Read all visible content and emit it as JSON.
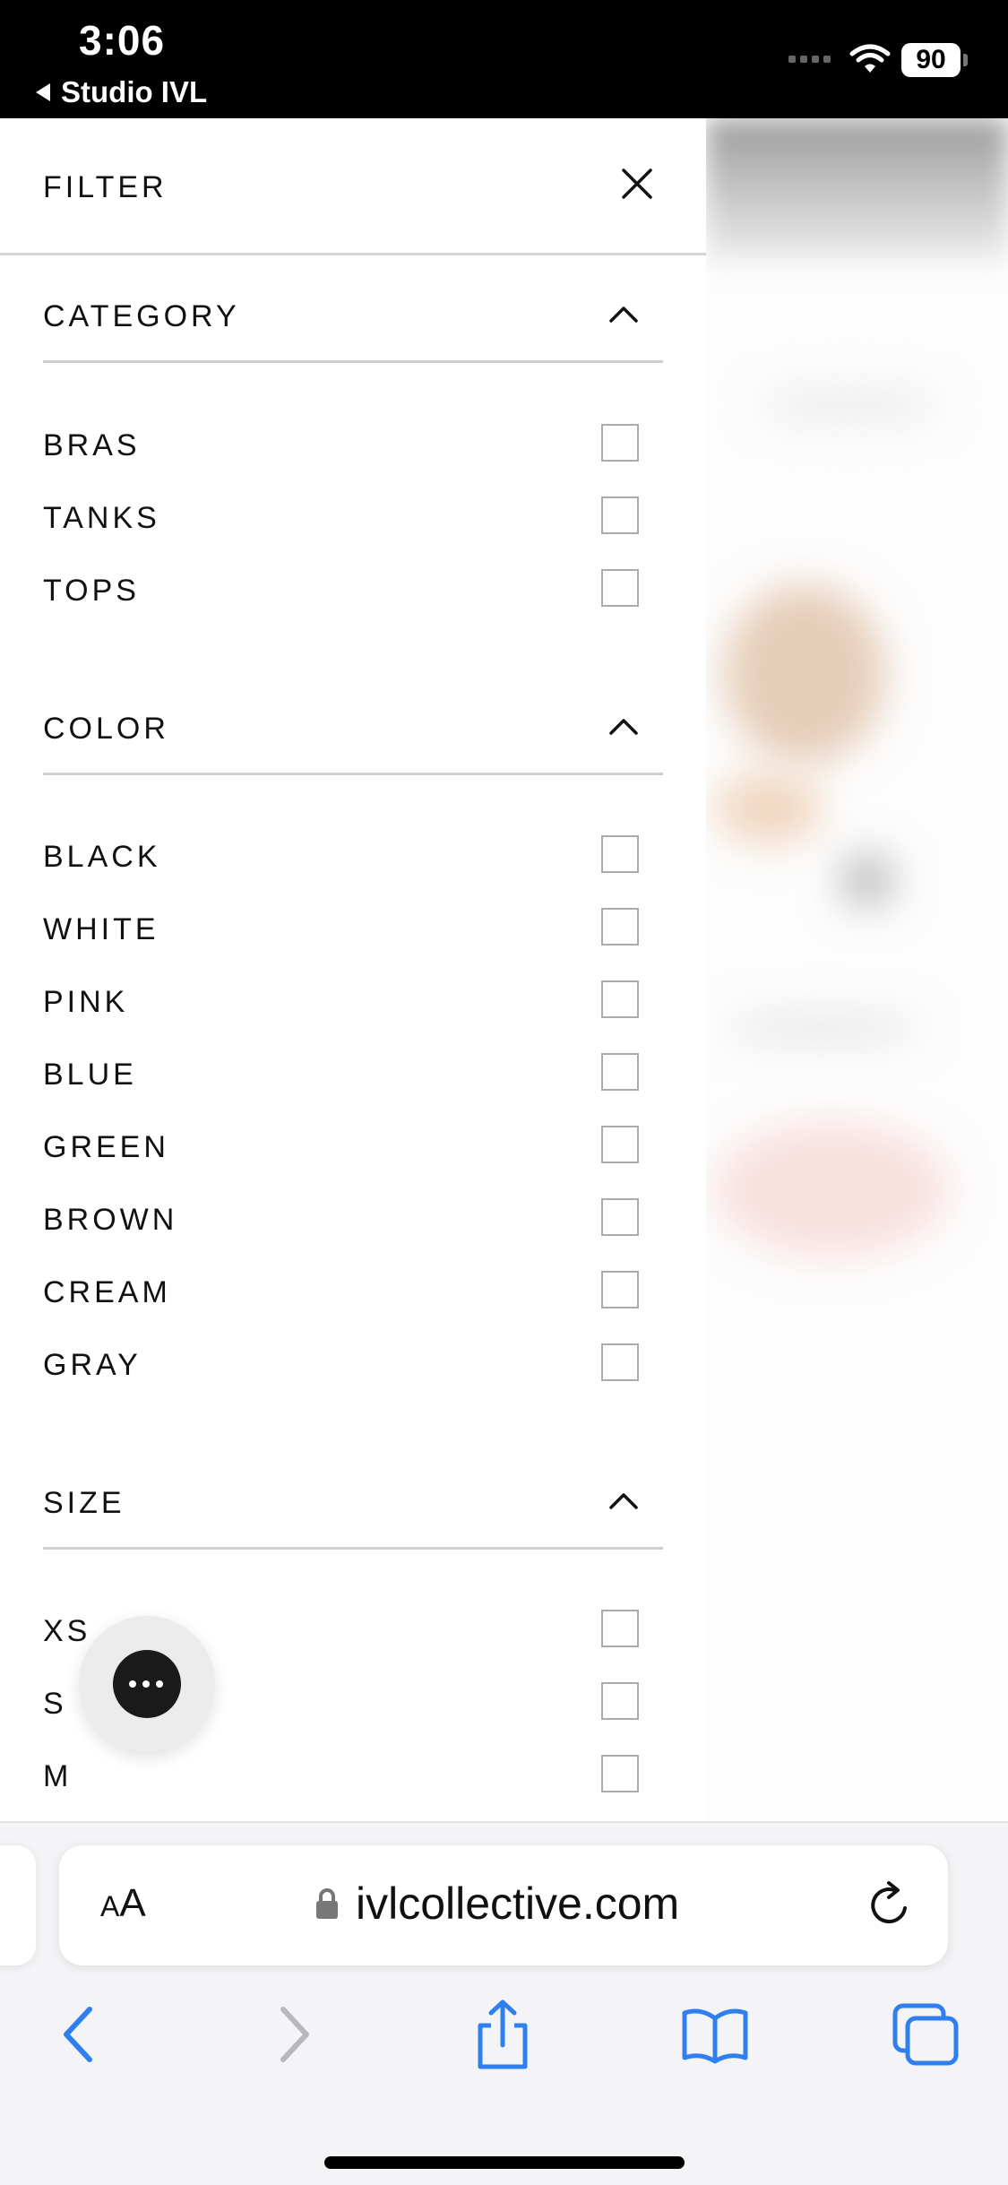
{
  "status_bar": {
    "time": "3:06",
    "back_app": "Studio IVL",
    "battery": "90"
  },
  "filter": {
    "title": "FILTER",
    "sections": [
      {
        "title": "CATEGORY",
        "options": [
          "BRAS",
          "TANKS",
          "TOPS"
        ]
      },
      {
        "title": "COLOR",
        "options": [
          "BLACK",
          "WHITE",
          "PINK",
          "BLUE",
          "GREEN",
          "BROWN",
          "CREAM",
          "GRAY"
        ]
      },
      {
        "title": "SIZE",
        "options": [
          "XS",
          "S",
          "M"
        ]
      }
    ]
  },
  "browser": {
    "text_size_label_small": "A",
    "text_size_label_large": "A",
    "url": "ivlcollective.com"
  },
  "colors": {
    "accent": "#2f7ff0",
    "text": "#111111",
    "divider": "#cfcfcf"
  },
  "icons": [
    "close-icon",
    "chevron-up-icon",
    "chat-icon",
    "lock-icon",
    "reload-icon",
    "back-icon",
    "forward-icon",
    "share-icon",
    "bookmarks-icon",
    "tabs-icon"
  ]
}
